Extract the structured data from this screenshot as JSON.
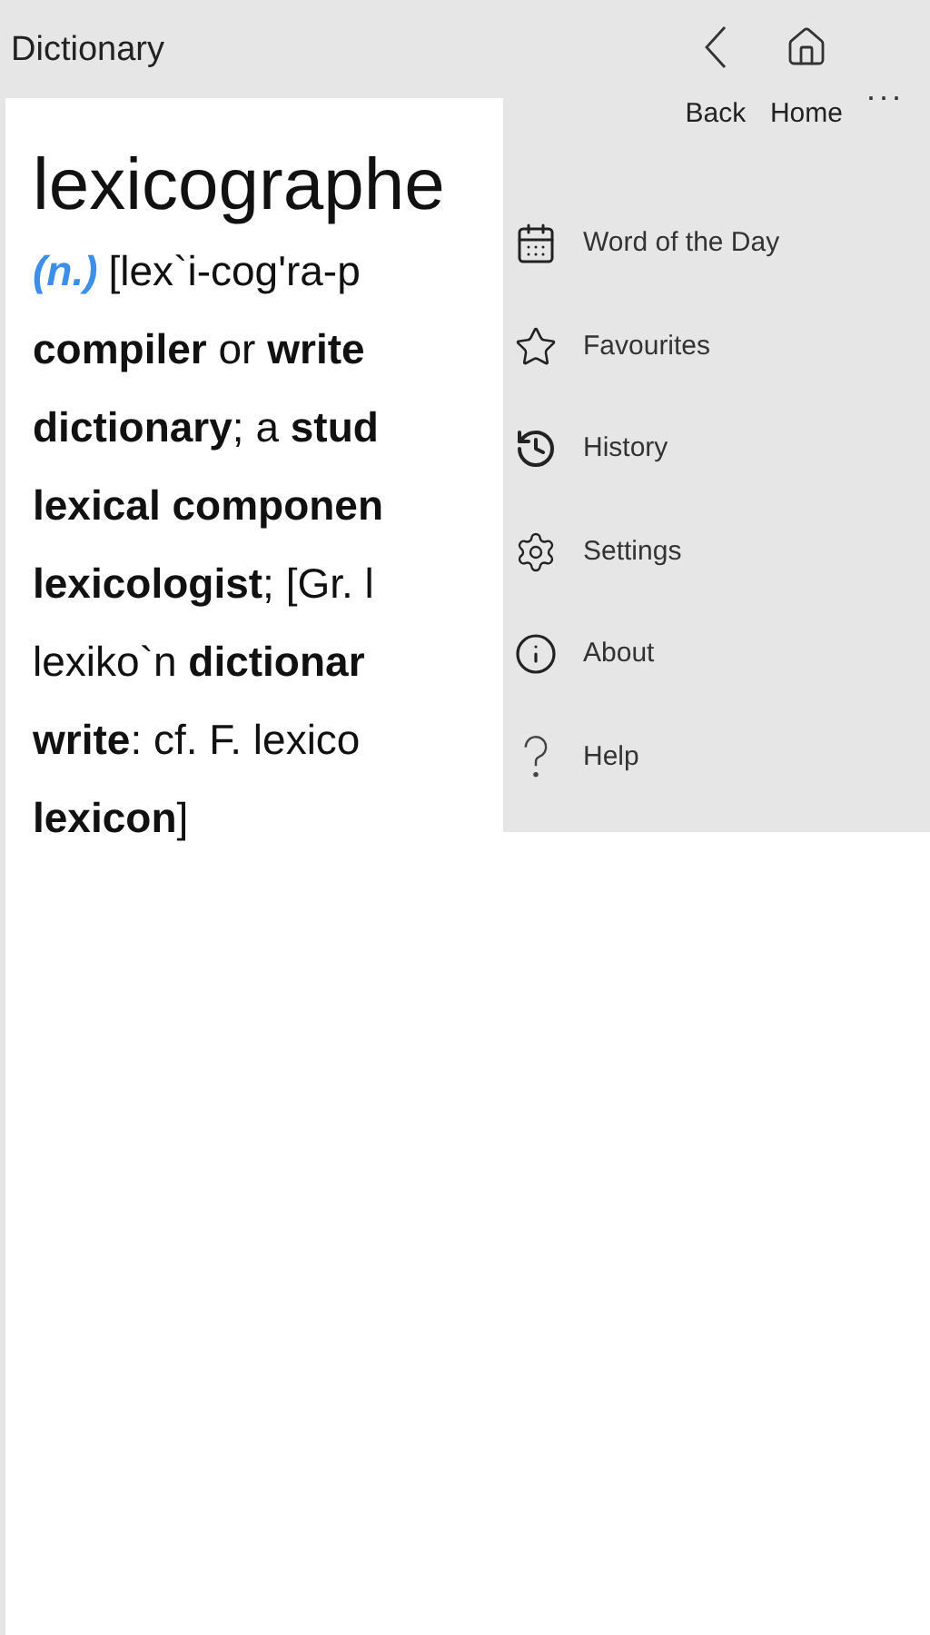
{
  "app_title": "Dictionary",
  "nav_buttons": [
    {
      "kind": "back",
      "label": "Back"
    },
    {
      "kind": "home",
      "label": "Home"
    }
  ],
  "more_button": "...",
  "entry": {
    "headword": "lexicographe",
    "part_of_speech": "(n.)",
    "lines": [
      "[lex`i-cog'ra-p",
      "**compiler** or **write**",
      "**dictionary**; a **stud**",
      "**lexical componen**",
      "**lexicologist**; [Gr. l",
      "lexiko`n **dictionar**",
      "**write**: cf. F. lexico",
      "**lexicon**]"
    ]
  },
  "menu": [
    {
      "kind": "calendar",
      "label": "Word of the Day"
    },
    {
      "kind": "star",
      "label": "Favourites"
    },
    {
      "kind": "history",
      "label": "History"
    },
    {
      "kind": "gear",
      "label": "Settings"
    },
    {
      "kind": "info",
      "label": "About"
    },
    {
      "kind": "help",
      "label": "Help"
    }
  ]
}
